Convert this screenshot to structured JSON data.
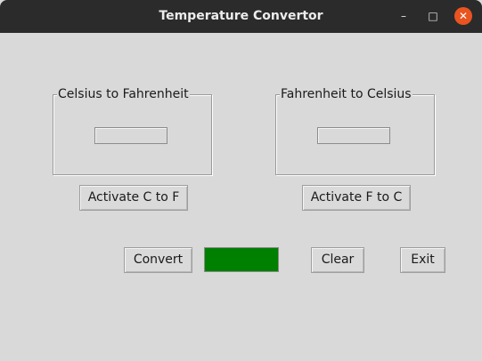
{
  "window": {
    "title": "Temperature Convertor",
    "minimize_glyph": "–",
    "maximize_glyph": "□",
    "close_glyph": "✕"
  },
  "c_to_f": {
    "group_label": "Celsius to Fahrenheit",
    "input_value": "",
    "activate_label": "Activate C to F"
  },
  "f_to_c": {
    "group_label": "Fahrenheit to Celsius",
    "input_value": "",
    "activate_label": "Activate F to C"
  },
  "actions": {
    "convert_label": "Convert",
    "result_text": "",
    "clear_label": "Clear",
    "exit_label": "Exit"
  },
  "colors": {
    "result_background": "#008000",
    "close_button": "#e95420",
    "titlebar": "#2b2b2b",
    "window_background": "#d9d9d9"
  }
}
